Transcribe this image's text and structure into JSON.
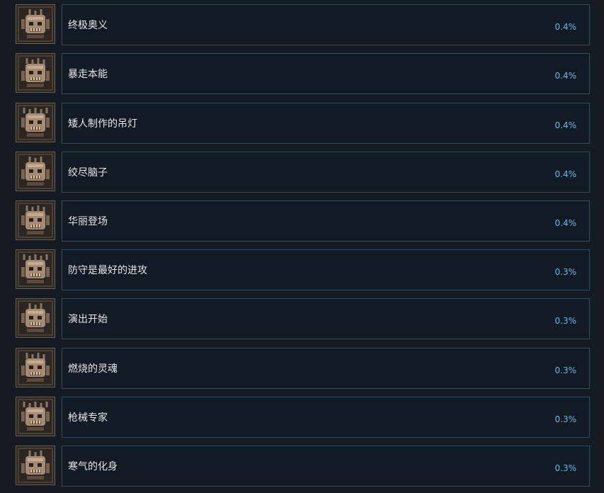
{
  "colors": {
    "background": "#151b23",
    "card_border": "#2f4d62",
    "name_text": "#e4e7ea",
    "percent_text": "#69b6ea",
    "icon_frame": "#6a5f50"
  },
  "achievements": [
    {
      "name": "终极奥义",
      "percent": "0.4%",
      "icon": "ultimate-art-icon"
    },
    {
      "name": "暴走本能",
      "percent": "0.4%",
      "icon": "rampage-instinct-icon"
    },
    {
      "name": "矮人制作的吊灯",
      "percent": "0.4%",
      "icon": "dwarf-chandelier-icon"
    },
    {
      "name": "绞尽脑子",
      "percent": "0.4%",
      "icon": "racking-brains-icon"
    },
    {
      "name": "华丽登场",
      "percent": "0.4%",
      "icon": "grand-entrance-icon"
    },
    {
      "name": "防守是最好的进攻",
      "percent": "0.3%",
      "icon": "defense-offense-icon"
    },
    {
      "name": "演出开始",
      "percent": "0.3%",
      "icon": "show-begins-icon"
    },
    {
      "name": "燃烧的灵魂",
      "percent": "0.3%",
      "icon": "burning-soul-icon"
    },
    {
      "name": "枪械专家",
      "percent": "0.3%",
      "icon": "firearms-expert-icon"
    },
    {
      "name": "寒气的化身",
      "percent": "0.3%",
      "icon": "frost-incarnate-icon"
    }
  ]
}
